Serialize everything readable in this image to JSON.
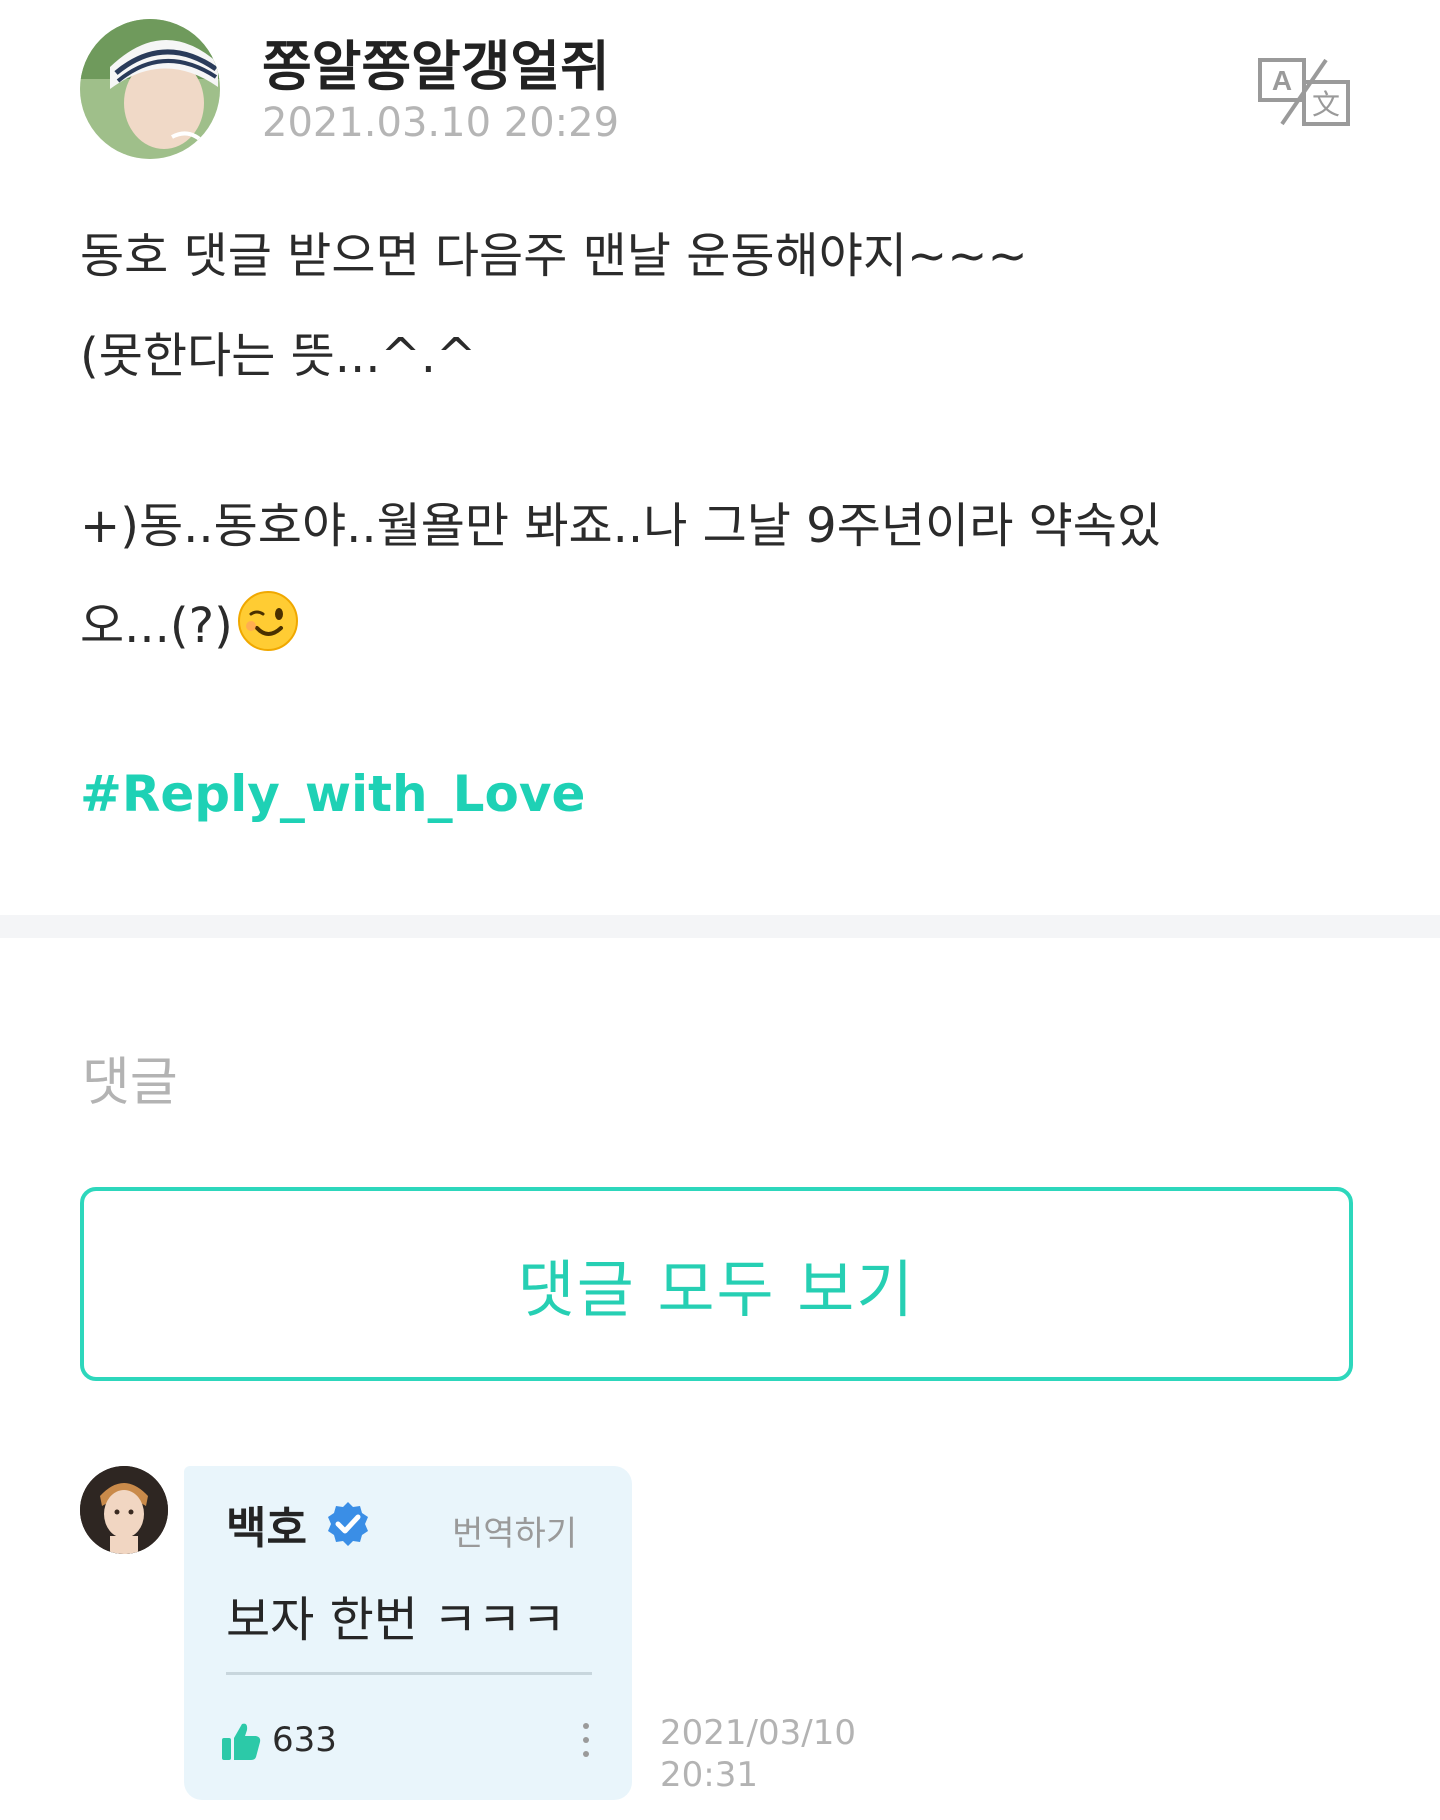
{
  "post": {
    "author": "쫑알쫑알갱얼쥐",
    "date": "2021.03.10 20:29",
    "lines": [
      "동호 댓글 받으면 다음주 맨날 운동해야지~~~",
      "(못한다는 뜻...^.^",
      "",
      "+)동..동호야..월욜만 봐죠..나 그날 9주년이라 약속있",
      "오...(?)"
    ],
    "emoji": "winking-face",
    "hashtag": "#Reply_with_Love",
    "translate_icon": "translate-icon"
  },
  "comments": {
    "heading": "댓글",
    "view_all_label": "댓글 모두 보기",
    "items": [
      {
        "name": "백호",
        "verified": true,
        "translate_label": "번역하기",
        "text": "보자 한번 ㅋㅋㅋ",
        "likes": "633",
        "date_line1": "2021/03/10",
        "date_line2": "20:31"
      }
    ]
  },
  "colors": {
    "accent": "#1ed1b5",
    "bubble": "#e9f5fb",
    "verified": "#3a8ee6"
  }
}
